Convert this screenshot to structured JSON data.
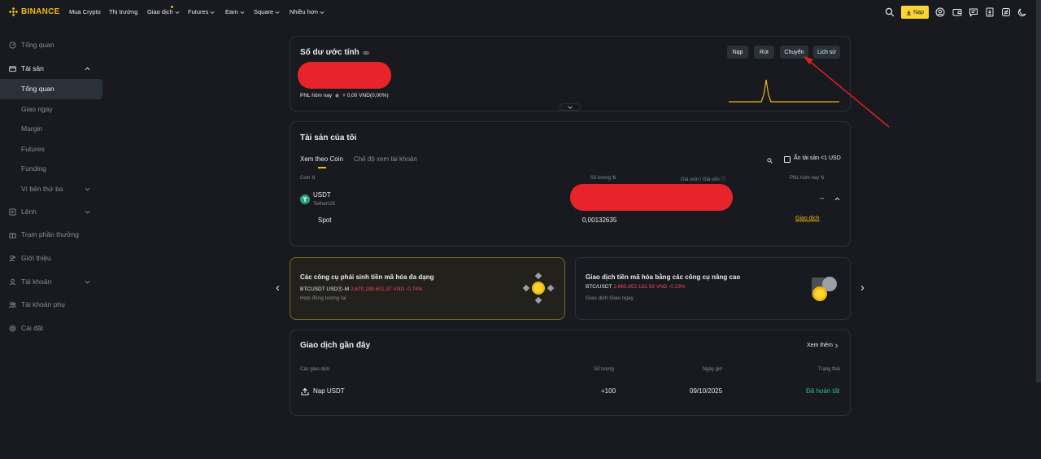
{
  "topnav": {
    "brand": "BINANCE",
    "items": [
      {
        "label": "Mua Crypto"
      },
      {
        "label": "Thị trường"
      },
      {
        "label": "Giao dịch"
      },
      {
        "label": "Futures"
      },
      {
        "label": "Earn"
      },
      {
        "label": "Square"
      },
      {
        "label": "Nhiều hơn"
      }
    ],
    "deposit_label": "Nạp"
  },
  "sidebar": {
    "items": [
      {
        "label": "Tổng quan"
      },
      {
        "label": "Tài sản"
      },
      {
        "label": "Lệnh"
      },
      {
        "label": "Trạm phần thưởng"
      },
      {
        "label": "Giới thiệu"
      },
      {
        "label": "Tài khoản"
      },
      {
        "label": "Tài khoản phụ"
      },
      {
        "label": "Cài đặt"
      }
    ],
    "sub_items": [
      {
        "label": "Tổng quan"
      },
      {
        "label": "Giao ngay"
      },
      {
        "label": "Margin"
      },
      {
        "label": "Futures"
      },
      {
        "label": "Funding"
      },
      {
        "label": "Ví bên thứ ba"
      }
    ]
  },
  "balance": {
    "title": "Số dư ước tính",
    "pnl_label": "PNL hôm nay",
    "pnl_value": "+ 0,00 VND(0,00%)",
    "buttons": {
      "deposit": "Nạp",
      "withdraw": "Rút",
      "transfer": "Chuyển",
      "history": "Lịch sử"
    }
  },
  "assets": {
    "title": "Tài sản của tôi",
    "tabs": {
      "by_coin": "Xem theo Coin",
      "by_account": "Chế độ xem tài khoản"
    },
    "hide_small": "Ẩn tài sản <1 USD",
    "headers": {
      "coin": "Coin",
      "amount": "Số lượng",
      "price": "Giá coin / Giá vốn",
      "pnl": "PNL hôm nay"
    },
    "row": {
      "symbol": "USDT",
      "name": "TetherUS",
      "pnl": "--"
    },
    "sub_row": {
      "account": "Spot",
      "amount": "0,00132635",
      "action": "Giao dịch"
    }
  },
  "promos": [
    {
      "title": "Các công cụ phái sinh tiền mã hóa đa dạng",
      "pair": "BTCUSDT USDⓈ-M",
      "quote": "2.670.198.601,37 VND -0,74%",
      "sub": "Hợp đồng tương lai"
    },
    {
      "title": "Giao dịch tiền mã hóa bằng các công cụ nâng cao",
      "pair": "BTC/USDT",
      "quote": "2.665.852.182,59 VND -0,23%",
      "sub": "Giao dịch Giao ngay"
    }
  ],
  "recent": {
    "title": "Giao dịch gần đây",
    "see_more": "Xem thêm",
    "headers": {
      "type": "Các giao dịch",
      "amount": "Số lượng",
      "date": "Ngày giờ",
      "status": "Trạng thái"
    },
    "row": {
      "type": "Nạp USDT",
      "amount": "+100",
      "date": "09/10/2025",
      "status": "Đã hoàn tất"
    }
  },
  "colors": {
    "accent": "#f0b90b",
    "bg": "#181a20",
    "panel": "#2b3139",
    "muted": "#848e9c",
    "green": "#2ebd85",
    "red": "#f6465d",
    "annotation": "#e02020"
  }
}
